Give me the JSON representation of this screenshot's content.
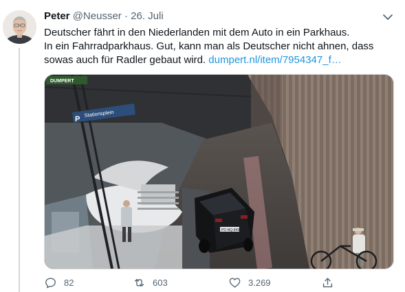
{
  "tweet": {
    "author_name": "Peter",
    "handle": "@Neusser",
    "separator": "·",
    "date": "26. Juli",
    "text_line1": "Deutscher fährt in den Niederlanden mit dem Auto in ein Parkhaus.",
    "text_line2": "In ein Fahrradparkhaus. Gut, kann man als Deutscher nicht ahnen, dass",
    "text_line3": "sowas auch für Radler gebaut wird.",
    "link_text": "dumpert.nl/item/7954347_f…"
  },
  "media": {
    "sign_dumpert": "DUMPERT",
    "sign_station": "Stationsplein",
    "sign_p": "P",
    "plate": "PD-NQ-849"
  },
  "actions": {
    "replies": "82",
    "retweets": "603",
    "likes": "3.269"
  },
  "icons": {
    "reply": "reply-icon",
    "retweet": "retweet-icon",
    "like": "heart-icon",
    "share": "share-icon",
    "more": "chevron-down-icon"
  },
  "colors": {
    "link": "#1b95e0",
    "secondary_text": "#536471"
  }
}
